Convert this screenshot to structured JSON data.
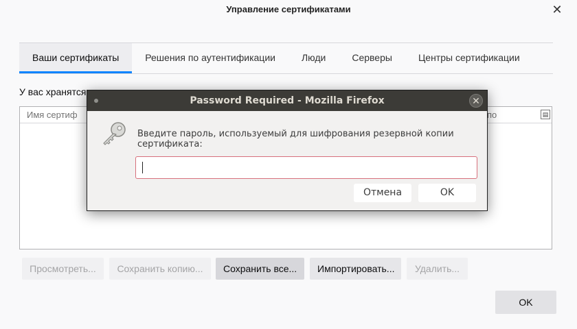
{
  "window": {
    "title": "Управление сертификатами",
    "close_glyph": "✕"
  },
  "tabs": [
    {
      "label": "Ваши сертификаты",
      "active": true
    },
    {
      "label": "Решения по аутентификации"
    },
    {
      "label": "Люди"
    },
    {
      "label": "Серверы"
    },
    {
      "label": "Центры сертификации"
    }
  ],
  "intro_text": "У вас хранятся",
  "table": {
    "columns": [
      "Имя сертиф",
      "по"
    ],
    "picker_icon": "column-picker-icon"
  },
  "buttons": {
    "view": "Просмотреть...",
    "backup": "Сохранить копию...",
    "backup_all": "Сохранить все...",
    "import": "Импортировать...",
    "delete": "Удалить...",
    "ok": "OK"
  },
  "dialog": {
    "title": "Password Required - Mozilla Firefox",
    "message": "Введите пароль, используемый для шифрования резервной копии сертификата:",
    "password_value": "",
    "cancel_label": "Отмена",
    "ok_label": "OK",
    "icon": "key-icon",
    "close_glyph": "✕"
  },
  "colors": {
    "accent": "#0a84ff",
    "dialog_titlebar": "#3c3b37",
    "input_border": "#d76f7b"
  }
}
